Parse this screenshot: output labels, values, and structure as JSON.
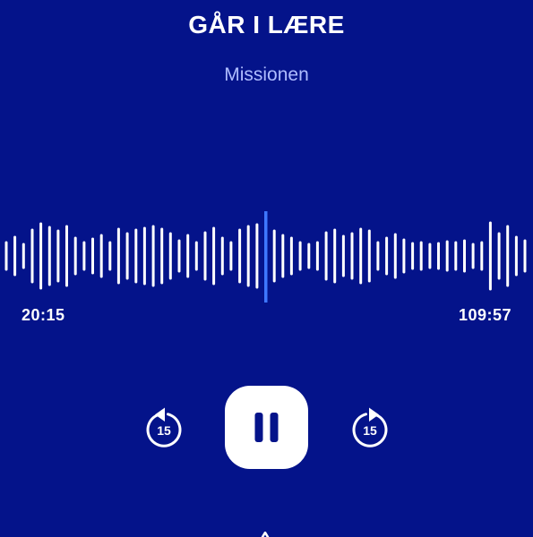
{
  "player": {
    "episode_title": "GÅR I LÆRE",
    "podcast_name": "Missionen",
    "elapsed_time": "20:15",
    "remaining_time": "109:57",
    "skip_back_seconds": "15",
    "skip_forward_seconds": "15",
    "state": "playing",
    "progress_fraction": 0.5
  },
  "colors": {
    "background": "#04138a",
    "foreground": "#ffffff",
    "subtitle": "#aebcff",
    "playhead": "#3e78ff"
  },
  "icons": {
    "skip_back": "rotate-back-15-icon",
    "pause": "pause-icon",
    "skip_forward": "rotate-forward-15-icon"
  }
}
